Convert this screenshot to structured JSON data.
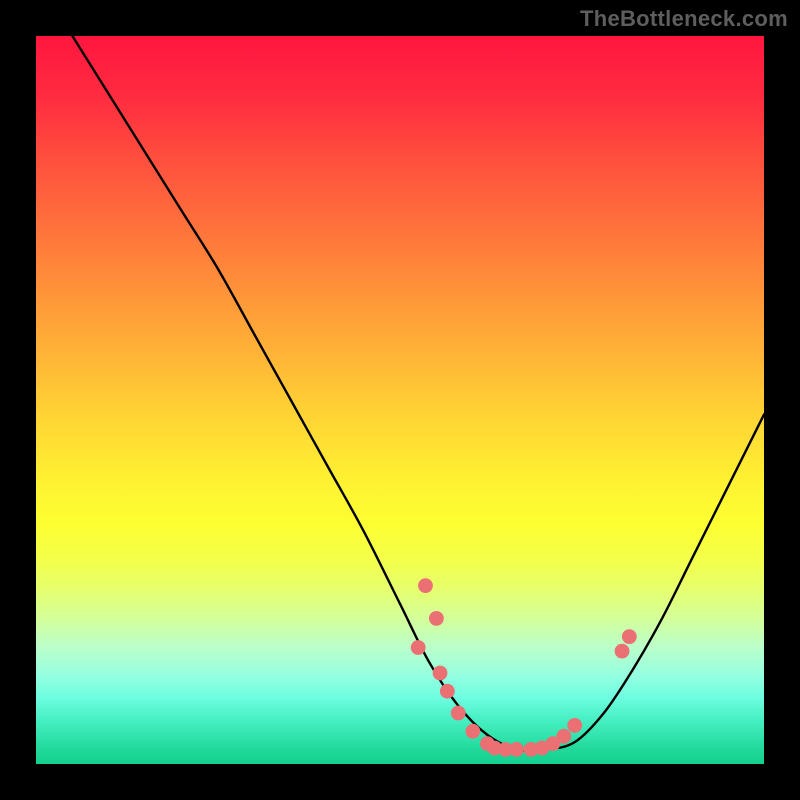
{
  "watermark": "TheBottleneck.com",
  "chart_data": {
    "type": "line",
    "title": "",
    "xlabel": "",
    "ylabel": "",
    "xlim": [
      0,
      100
    ],
    "ylim": [
      0,
      100
    ],
    "curve": {
      "x": [
        5,
        10,
        15,
        20,
        25,
        30,
        35,
        40,
        45,
        50,
        54,
        58,
        62,
        66,
        70,
        74,
        78,
        82,
        86,
        90,
        94,
        100
      ],
      "y": [
        100,
        92,
        84,
        76,
        68,
        59,
        50,
        41,
        32,
        22,
        14,
        8,
        4,
        2,
        2,
        3,
        7,
        13,
        20,
        28,
        36,
        48
      ]
    },
    "points": [
      {
        "x": 52.5,
        "y": 16
      },
      {
        "x": 53.5,
        "y": 24.5
      },
      {
        "x": 55.0,
        "y": 20
      },
      {
        "x": 55.5,
        "y": 12.5
      },
      {
        "x": 56.5,
        "y": 10
      },
      {
        "x": 58.0,
        "y": 7
      },
      {
        "x": 60.0,
        "y": 4.5
      },
      {
        "x": 62.0,
        "y": 2.8
      },
      {
        "x": 63.0,
        "y": 2.2
      },
      {
        "x": 64.5,
        "y": 2.0
      },
      {
        "x": 66.0,
        "y": 2.0
      },
      {
        "x": 68.0,
        "y": 2.0
      },
      {
        "x": 69.5,
        "y": 2.2
      },
      {
        "x": 71.0,
        "y": 2.8
      },
      {
        "x": 72.5,
        "y": 3.8
      },
      {
        "x": 74.0,
        "y": 5.3
      },
      {
        "x": 80.5,
        "y": 15.5
      },
      {
        "x": 81.5,
        "y": 17.5
      }
    ],
    "gradient_stops": [
      {
        "pos": 0,
        "color": "#ff163f"
      },
      {
        "pos": 50,
        "color": "#ffd334"
      },
      {
        "pos": 100,
        "color": "#14d18f"
      }
    ]
  }
}
